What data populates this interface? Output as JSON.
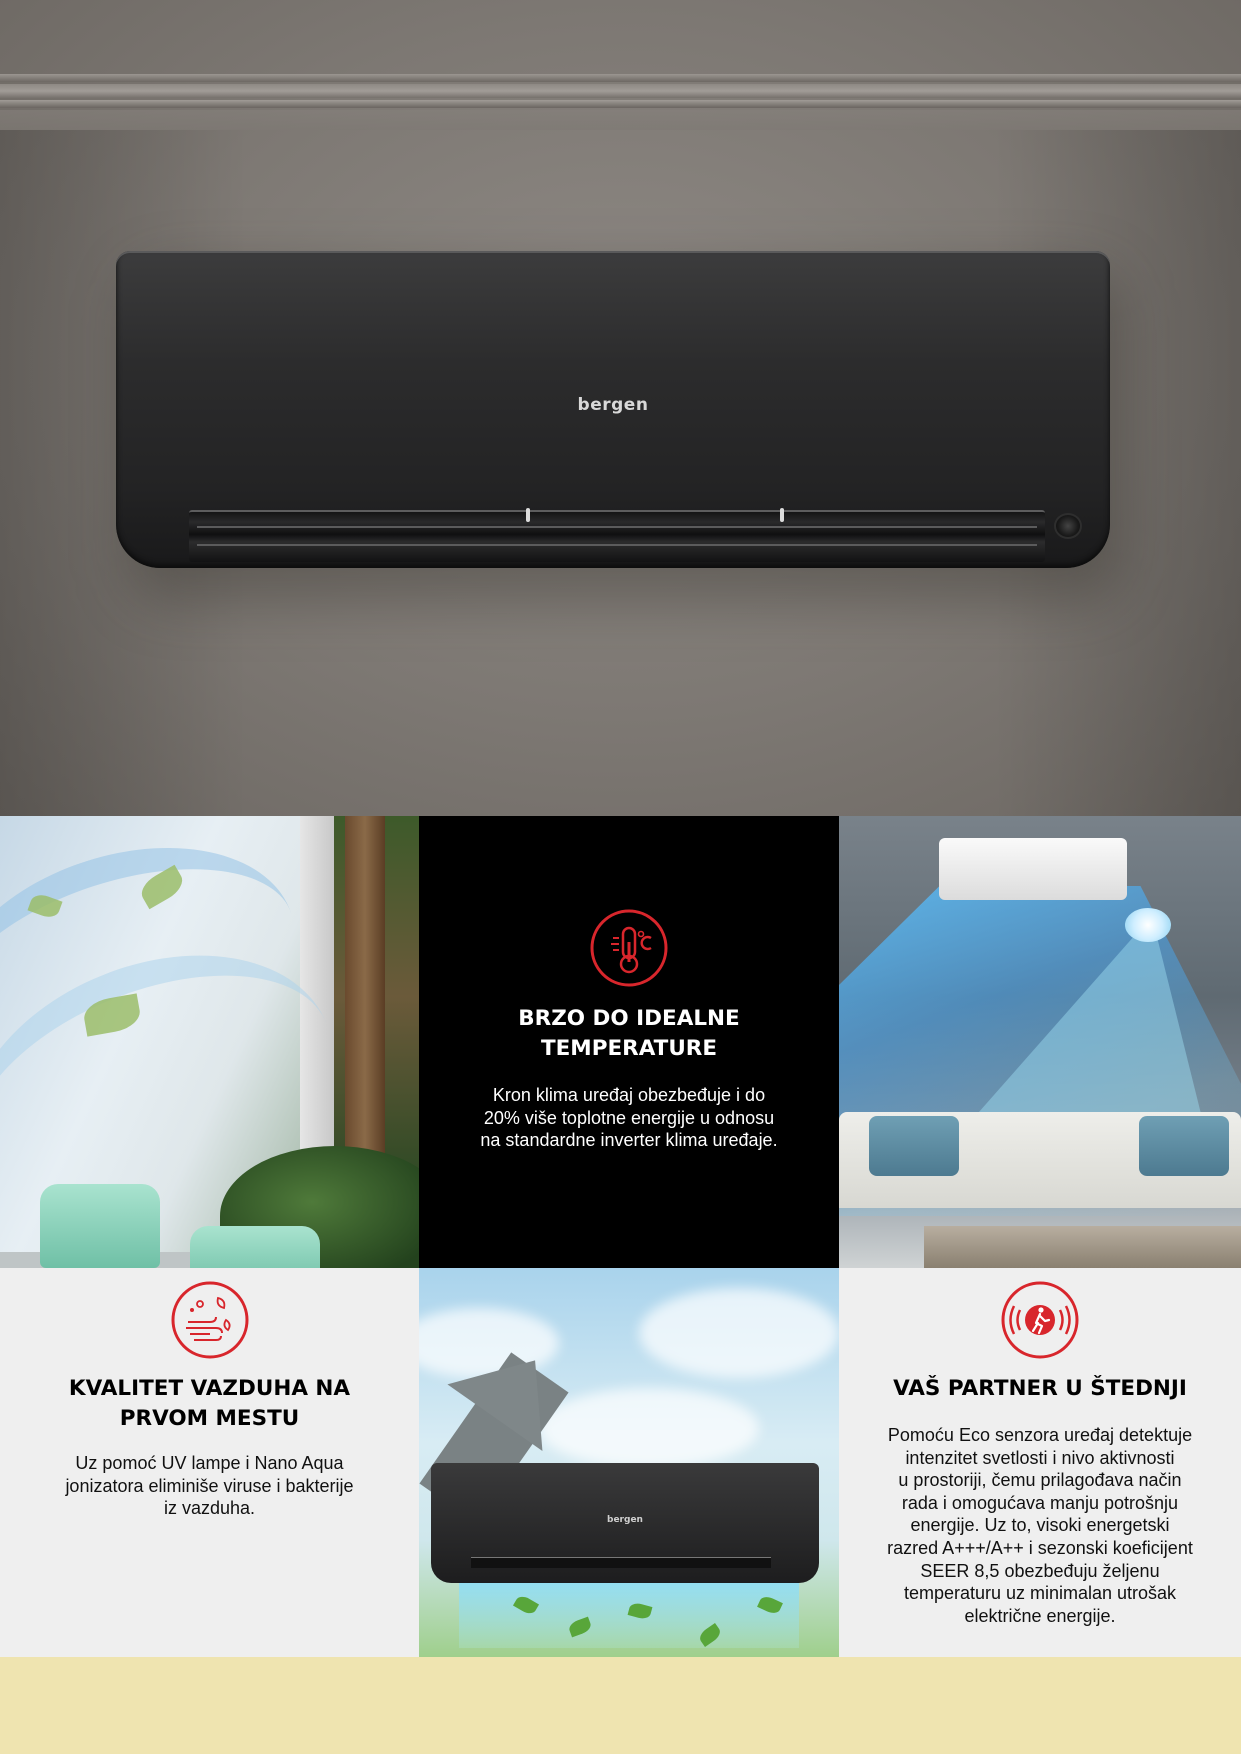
{
  "hero": {
    "brand": "bergen",
    "icon": "air-conditioner-unit"
  },
  "features": {
    "temperature": {
      "icon": "thermometer-celsius-icon",
      "title_line1": "BRZO DO IDEALNE",
      "title_line2": "TEMPERATURE",
      "body_line1": "Kron klima uređaj obezbeđuje i do",
      "body_line2": "20% više toplotne energije u odnosu",
      "body_line3": "na standardne inverter klima uređaje."
    },
    "air_quality": {
      "icon": "air-purification-icon",
      "title_line1": "KVALITET VAZDUHA NA",
      "title_line2": "PRVOM MESTU",
      "body_line1": "Uz pomoć UV lampe i Nano Aqua",
      "body_line2": "jonizatora eliminiše viruse i bakterije",
      "body_line3": "iz vazduha."
    },
    "savings": {
      "icon": "motion-sensor-person-icon",
      "title": "VAŠ PARTNER U ŠTEDNJI",
      "body_lines": [
        "Pomoću Eco senzora uređaj detektuje",
        "intenzitet svetlosti i nivo aktivnosti",
        "u prostoriji, čemu prilagođava način",
        "rada i omogućava manju potrošnju",
        "energije. Uz to, visoki energetski",
        "razred A+++/A++ i sezonski koeficijent",
        "SEER 8,5 obezbeđuju željenu",
        "temperaturu uz minimalan utrošak",
        "električne energije."
      ]
    }
  },
  "photo_unit_brand": "bergen",
  "colors": {
    "accent_red": "#d8262c",
    "panel_black": "#000000",
    "panel_gray": "#efefef",
    "footer_cream": "#efe4b0"
  }
}
